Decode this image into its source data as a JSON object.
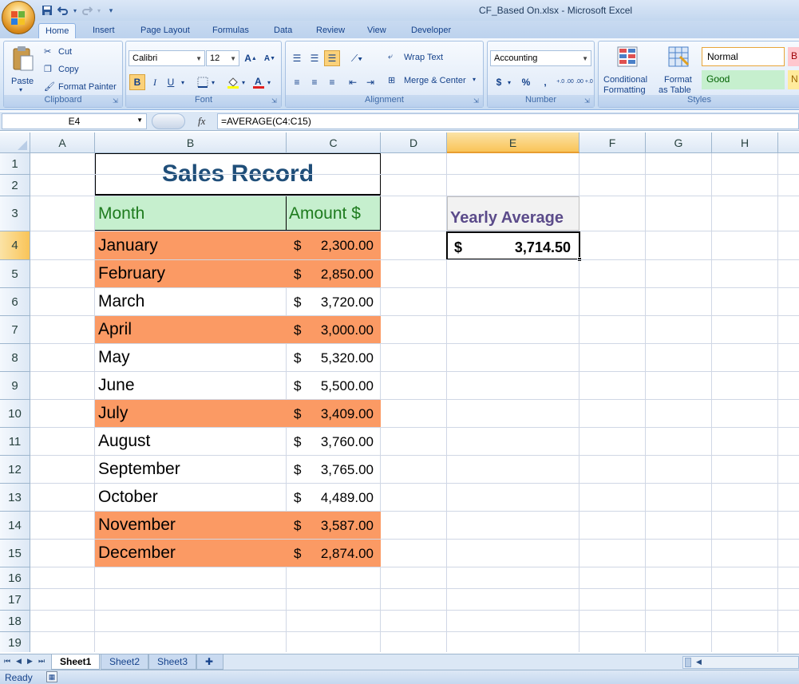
{
  "window": {
    "title": "CF_Based On.xlsx - Microsoft Excel"
  },
  "ribbon": {
    "tabs": [
      "Home",
      "Insert",
      "Page Layout",
      "Formulas",
      "Data",
      "Review",
      "View",
      "Developer"
    ],
    "clipboard": {
      "paste": "Paste",
      "cut": "Cut",
      "copy": "Copy",
      "format_painter": "Format Painter",
      "label": "Clipboard"
    },
    "font": {
      "name": "Calibri",
      "size": "12",
      "grow": "A",
      "shrink": "A",
      "bold": "B",
      "italic": "I",
      "underline": "U",
      "label": "Font"
    },
    "alignment": {
      "wrap_text": "Wrap Text",
      "merge_center": "Merge & Center",
      "label": "Alignment"
    },
    "number": {
      "format": "Accounting",
      "currency": "$",
      "percent": "%",
      "comma": ",",
      "inc_decimal": "+.0 .00",
      "dec_decimal": ".00 +.0",
      "label": "Number"
    },
    "styles": {
      "conditional_1": "Conditional",
      "conditional_2": "Formatting",
      "format_table_1": "Format",
      "format_table_2": "as Table",
      "normal": "Normal",
      "good": "Good",
      "bad_partial": "B",
      "neutral_partial": "N",
      "label": "Styles"
    }
  },
  "formula_bar": {
    "name_box": "E4",
    "fx": "fx",
    "formula": "=AVERAGE(C4:C15)"
  },
  "columns": [
    "A",
    "B",
    "C",
    "D",
    "E",
    "F",
    "G",
    "H"
  ],
  "rows": [
    "1",
    "2",
    "3",
    "4",
    "5",
    "6",
    "7",
    "8",
    "9",
    "10",
    "11",
    "12",
    "13",
    "14",
    "15",
    "16",
    "17",
    "18",
    "19"
  ],
  "sheet": {
    "title": "Sales Record",
    "header_month": "Month",
    "header_amount": "Amount $",
    "currency_symbol": "$",
    "records": [
      {
        "month": "January",
        "amount": "2,300.00",
        "highlight": true
      },
      {
        "month": "February",
        "amount": "2,850.00",
        "highlight": true
      },
      {
        "month": "March",
        "amount": "3,720.00",
        "highlight": false
      },
      {
        "month": "April",
        "amount": "3,000.00",
        "highlight": true
      },
      {
        "month": "May",
        "amount": "5,320.00",
        "highlight": false
      },
      {
        "month": "June",
        "amount": "5,500.00",
        "highlight": false
      },
      {
        "month": "July",
        "amount": "3,409.00",
        "highlight": true
      },
      {
        "month": "August",
        "amount": "3,760.00",
        "highlight": false
      },
      {
        "month": "September",
        "amount": "3,765.00",
        "highlight": false
      },
      {
        "month": "October",
        "amount": "4,489.00",
        "highlight": false
      },
      {
        "month": "November",
        "amount": "3,587.00",
        "highlight": true
      },
      {
        "month": "December",
        "amount": "2,874.00",
        "highlight": true
      }
    ],
    "average_label": "Yearly Average",
    "average_value": "3,714.50"
  },
  "colors": {
    "highlight": "#fb9a64",
    "header_green_fill": "#c6efce",
    "header_green_text": "#1e7b1e",
    "title_blue": "#1f4e79",
    "avg_purple": "#5b4b8a"
  },
  "sheet_tabs": [
    "Sheet1",
    "Sheet2",
    "Sheet3"
  ],
  "status": {
    "text": "Ready"
  }
}
